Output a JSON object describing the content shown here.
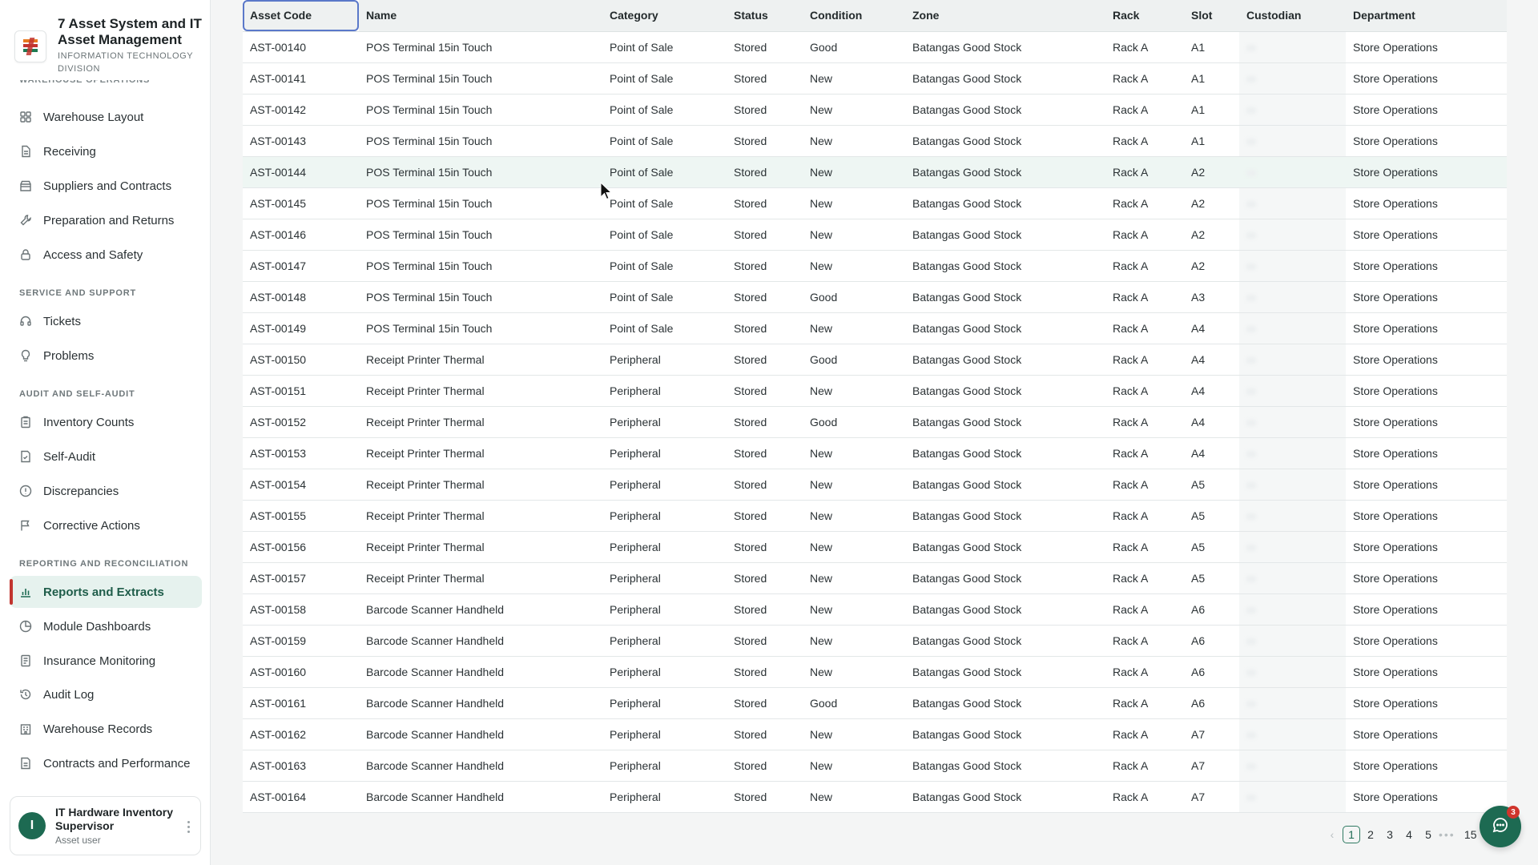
{
  "app": {
    "title": "7 Asset System and IT Asset Management",
    "subtitle": "INFORMATION TECHNOLOGY DIVISION"
  },
  "sidebar": {
    "cut_section": "WAREHOUSE OPERATIONS",
    "items_warehouse": [
      {
        "label": "Warehouse Layout",
        "icon": "grid-icon"
      },
      {
        "label": "Receiving",
        "icon": "document-icon"
      },
      {
        "label": "Suppliers and Contracts",
        "icon": "store-icon"
      },
      {
        "label": "Preparation and Returns",
        "icon": "wrench-icon"
      },
      {
        "label": "Access and Safety",
        "icon": "lock-icon"
      }
    ],
    "section_service": "SERVICE AND SUPPORT",
    "items_service": [
      {
        "label": "Tickets",
        "icon": "headset-icon"
      },
      {
        "label": "Problems",
        "icon": "lightbulb-icon"
      }
    ],
    "section_audit": "AUDIT AND SELF-AUDIT",
    "items_audit": [
      {
        "label": "Inventory Counts",
        "icon": "clipboard-icon"
      },
      {
        "label": "Self-Audit",
        "icon": "checklist-icon"
      },
      {
        "label": "Discrepancies",
        "icon": "alert-circle-icon"
      },
      {
        "label": "Corrective Actions",
        "icon": "flag-icon"
      }
    ],
    "section_reporting": "REPORTING AND RECONCILIATION",
    "items_reporting": [
      {
        "label": "Reports and Extracts",
        "icon": "bar-chart-icon",
        "active": true
      },
      {
        "label": "Module Dashboards",
        "icon": "pie-chart-icon"
      },
      {
        "label": "Insurance Monitoring",
        "icon": "document-icon"
      },
      {
        "label": "Audit Log",
        "icon": "history-icon"
      },
      {
        "label": "Warehouse Records",
        "icon": "building-icon"
      },
      {
        "label": "Contracts and Performance",
        "icon": "document-icon"
      }
    ]
  },
  "user": {
    "initial": "I",
    "name": "IT Hardware Inventory Supervisor",
    "role": "Asset user"
  },
  "table": {
    "columns": [
      "Asset Code",
      "Name",
      "Category",
      "Status",
      "Condition",
      "Zone",
      "Rack",
      "Slot",
      "Custodian",
      "Department"
    ],
    "rows": [
      [
        "AST-00140",
        "POS Terminal 15in Touch",
        "Point of Sale",
        "Stored",
        "Good",
        "Batangas Good Stock",
        "Rack A",
        "A1",
        "",
        "Store Operations"
      ],
      [
        "AST-00141",
        "POS Terminal 15in Touch",
        "Point of Sale",
        "Stored",
        "New",
        "Batangas Good Stock",
        "Rack A",
        "A1",
        "",
        "Store Operations"
      ],
      [
        "AST-00142",
        "POS Terminal 15in Touch",
        "Point of Sale",
        "Stored",
        "New",
        "Batangas Good Stock",
        "Rack A",
        "A1",
        "",
        "Store Operations"
      ],
      [
        "AST-00143",
        "POS Terminal 15in Touch",
        "Point of Sale",
        "Stored",
        "New",
        "Batangas Good Stock",
        "Rack A",
        "A1",
        "",
        "Store Operations"
      ],
      [
        "AST-00144",
        "POS Terminal 15in Touch",
        "Point of Sale",
        "Stored",
        "New",
        "Batangas Good Stock",
        "Rack A",
        "A2",
        "",
        "Store Operations"
      ],
      [
        "AST-00145",
        "POS Terminal 15in Touch",
        "Point of Sale",
        "Stored",
        "New",
        "Batangas Good Stock",
        "Rack A",
        "A2",
        "",
        "Store Operations"
      ],
      [
        "AST-00146",
        "POS Terminal 15in Touch",
        "Point of Sale",
        "Stored",
        "New",
        "Batangas Good Stock",
        "Rack A",
        "A2",
        "",
        "Store Operations"
      ],
      [
        "AST-00147",
        "POS Terminal 15in Touch",
        "Point of Sale",
        "Stored",
        "New",
        "Batangas Good Stock",
        "Rack A",
        "A2",
        "",
        "Store Operations"
      ],
      [
        "AST-00148",
        "POS Terminal 15in Touch",
        "Point of Sale",
        "Stored",
        "Good",
        "Batangas Good Stock",
        "Rack A",
        "A3",
        "",
        "Store Operations"
      ],
      [
        "AST-00149",
        "POS Terminal 15in Touch",
        "Point of Sale",
        "Stored",
        "New",
        "Batangas Good Stock",
        "Rack A",
        "A4",
        "",
        "Store Operations"
      ],
      [
        "AST-00150",
        "Receipt Printer Thermal",
        "Peripheral",
        "Stored",
        "Good",
        "Batangas Good Stock",
        "Rack A",
        "A4",
        "",
        "Store Operations"
      ],
      [
        "AST-00151",
        "Receipt Printer Thermal",
        "Peripheral",
        "Stored",
        "New",
        "Batangas Good Stock",
        "Rack A",
        "A4",
        "",
        "Store Operations"
      ],
      [
        "AST-00152",
        "Receipt Printer Thermal",
        "Peripheral",
        "Stored",
        "Good",
        "Batangas Good Stock",
        "Rack A",
        "A4",
        "",
        "Store Operations"
      ],
      [
        "AST-00153",
        "Receipt Printer Thermal",
        "Peripheral",
        "Stored",
        "New",
        "Batangas Good Stock",
        "Rack A",
        "A4",
        "",
        "Store Operations"
      ],
      [
        "AST-00154",
        "Receipt Printer Thermal",
        "Peripheral",
        "Stored",
        "New",
        "Batangas Good Stock",
        "Rack A",
        "A5",
        "",
        "Store Operations"
      ],
      [
        "AST-00155",
        "Receipt Printer Thermal",
        "Peripheral",
        "Stored",
        "New",
        "Batangas Good Stock",
        "Rack A",
        "A5",
        "",
        "Store Operations"
      ],
      [
        "AST-00156",
        "Receipt Printer Thermal",
        "Peripheral",
        "Stored",
        "New",
        "Batangas Good Stock",
        "Rack A",
        "A5",
        "",
        "Store Operations"
      ],
      [
        "AST-00157",
        "Receipt Printer Thermal",
        "Peripheral",
        "Stored",
        "New",
        "Batangas Good Stock",
        "Rack A",
        "A5",
        "",
        "Store Operations"
      ],
      [
        "AST-00158",
        "Barcode Scanner Handheld",
        "Peripheral",
        "Stored",
        "New",
        "Batangas Good Stock",
        "Rack A",
        "A6",
        "",
        "Store Operations"
      ],
      [
        "AST-00159",
        "Barcode Scanner Handheld",
        "Peripheral",
        "Stored",
        "New",
        "Batangas Good Stock",
        "Rack A",
        "A6",
        "",
        "Store Operations"
      ],
      [
        "AST-00160",
        "Barcode Scanner Handheld",
        "Peripheral",
        "Stored",
        "New",
        "Batangas Good Stock",
        "Rack A",
        "A6",
        "",
        "Store Operations"
      ],
      [
        "AST-00161",
        "Barcode Scanner Handheld",
        "Peripheral",
        "Stored",
        "Good",
        "Batangas Good Stock",
        "Rack A",
        "A6",
        "",
        "Store Operations"
      ],
      [
        "AST-00162",
        "Barcode Scanner Handheld",
        "Peripheral",
        "Stored",
        "New",
        "Batangas Good Stock",
        "Rack A",
        "A7",
        "",
        "Store Operations"
      ],
      [
        "AST-00163",
        "Barcode Scanner Handheld",
        "Peripheral",
        "Stored",
        "New",
        "Batangas Good Stock",
        "Rack A",
        "A7",
        "",
        "Store Operations"
      ],
      [
        "AST-00164",
        "Barcode Scanner Handheld",
        "Peripheral",
        "Stored",
        "New",
        "Batangas Good Stock",
        "Rack A",
        "A7",
        "",
        "Store Operations"
      ]
    ],
    "hover_row_index": 4
  },
  "pagination": {
    "prev_symbol": "‹",
    "pages": [
      "1",
      "2",
      "3",
      "4",
      "5"
    ],
    "current": "1",
    "ellipsis": "•••",
    "last": "15"
  },
  "chat": {
    "badge": "3",
    "icon": "chat-bubble-icon"
  },
  "colors": {
    "accent": "#1d6a52",
    "active_bg": "#e6f2ee",
    "brand_red": "#c2352f",
    "badge_red": "#d0342c",
    "header_bg": "#eef1f1",
    "focus_outline": "#5a78c9"
  }
}
